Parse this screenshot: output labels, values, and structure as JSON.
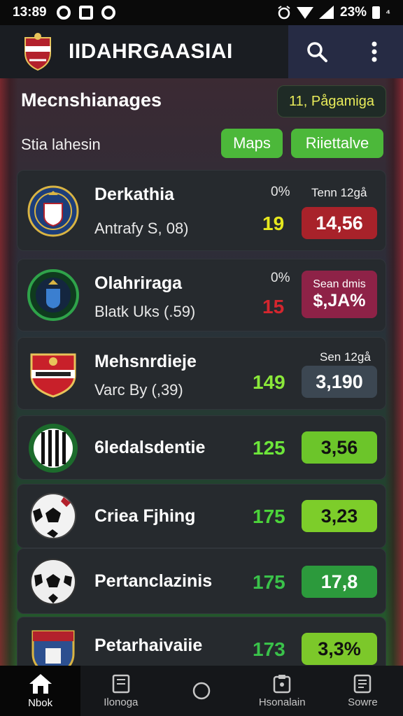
{
  "status_bar": {
    "time": "13:89",
    "battery": "23%"
  },
  "app": {
    "title": "IIDAHRGAASIAI"
  },
  "header": {
    "title": "Mecnshianages",
    "chip": "11, Pågamiga",
    "subtitle": "Stia lahesin",
    "maps_label": "Maps",
    "relative_label": "Riiettalve"
  },
  "matches": [
    {
      "name": "Derkathia",
      "sub": "Antrafy S, 08)",
      "pct": "0%",
      "top_label": "Tenn 12gå",
      "value": "19",
      "odds": "14,56",
      "value_color": "#e6e81e",
      "odds_bg": "#a8222a"
    },
    {
      "name": "Olahriraga",
      "sub": "Blatk Uks (.59)",
      "pct": "0%",
      "top_label": "",
      "value": "15",
      "odds": "Sean dmis $,JA%",
      "odds_line1": "Sean dmis",
      "odds_line2": "$,JA%",
      "value_color": "#d4262e",
      "odds_bg": "#8e2247"
    },
    {
      "name": "Mehsnrdieje",
      "sub": "Varc By (,39)",
      "pct": "",
      "top_label": "Sen 12gå",
      "value": "149",
      "odds": "3,190",
      "value_color": "#8be83a",
      "odds_bg": "#3c4752"
    },
    {
      "name": "6ledalsdentie",
      "sub": "",
      "pct": "",
      "top_label": "",
      "value": "125",
      "odds": "3,56",
      "value_color": "#6de63a",
      "odds_bg": "#6cc52a"
    },
    {
      "name": "Criea Fjhing",
      "sub": "",
      "pct": "",
      "top_label": "",
      "value": "175",
      "odds": "3,23",
      "value_color": "#4cd43a",
      "odds_bg": "#7dcd2a"
    },
    {
      "name": "Pertanclazinis",
      "sub": "",
      "pct": "",
      "top_label": "",
      "value": "175",
      "odds": "17,8",
      "value_color": "#3ac24a",
      "odds_bg": "#2c9a3c"
    },
    {
      "name": "Petarhaivaiie",
      "sub": "",
      "pct": "",
      "top_label": "",
      "value": "173",
      "odds": "3,3%",
      "value_color": "#3ac24a",
      "odds_bg": "#7cc82a"
    }
  ],
  "nav": [
    {
      "label": "Nbok",
      "icon": "home-icon",
      "active": true
    },
    {
      "label": "Ilonoga",
      "icon": "book-icon",
      "active": false
    },
    {
      "label": "",
      "icon": "circle-icon",
      "active": false
    },
    {
      "label": "Hsonalain",
      "icon": "clipboard-icon",
      "active": false
    },
    {
      "label": "Sowre",
      "icon": "receipt-icon",
      "active": false
    }
  ],
  "colors": {
    "appbar": "#1a1d22",
    "actions": "#262b44",
    "green": "#4cb83a",
    "card": "#262a2e"
  }
}
